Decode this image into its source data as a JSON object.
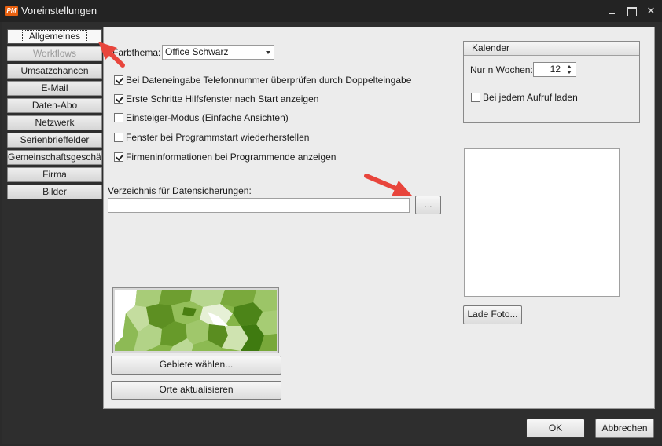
{
  "window": {
    "app_icon_text": "PM",
    "title": "Voreinstellungen",
    "minimize_label": "",
    "maximize_label": "",
    "close_label": "✕"
  },
  "nav": {
    "items": [
      {
        "label": "Allgemeines",
        "state": "active"
      },
      {
        "label": "Workflows",
        "state": "disabled"
      },
      {
        "label": "Umsatzchancen",
        "state": "normal"
      },
      {
        "label": "E-Mail",
        "state": "normal"
      },
      {
        "label": "Daten-Abo",
        "state": "normal"
      },
      {
        "label": "Netzwerk",
        "state": "normal"
      },
      {
        "label": "Serienbrieffelder",
        "state": "normal"
      },
      {
        "label": "Gemeinschaftsgeschäft",
        "state": "normal"
      },
      {
        "label": "Firma",
        "state": "normal"
      },
      {
        "label": "Bilder",
        "state": "normal"
      }
    ]
  },
  "general": {
    "theme_label": "Farbthema:",
    "theme_value": "Office Schwarz",
    "options": [
      {
        "label": "Bei Dateneingabe Telefonnummer überprüfen durch Doppelteingabe",
        "checked": true
      },
      {
        "label": "Erste Schritte Hilfsfenster nach Start anzeigen",
        "checked": true
      },
      {
        "label": "Einsteiger-Modus (Einfache Ansichten)",
        "checked": false
      },
      {
        "label": "Fenster bei Programmstart wiederherstellen",
        "checked": false
      },
      {
        "label": "Firmeninformationen bei Programmende anzeigen",
        "checked": true
      }
    ],
    "backup_dir_label": "Verzeichnis für Datensicherungen:",
    "backup_dir_value": "",
    "browse_label": "...",
    "gebiete_button": "Gebiete wählen...",
    "orte_button": "Orte aktualisieren"
  },
  "calendar": {
    "group_title": "Kalender",
    "weeks_label": "Nur n Wochen:",
    "weeks_value": "12",
    "load_each_label": "Bei jedem Aufruf laden",
    "load_each_checked": false
  },
  "photo": {
    "load_button": "Lade Foto..."
  },
  "footer": {
    "ok_label": "OK",
    "cancel_label": "Abbrechen"
  },
  "colors": {
    "annotation_arrow": "#e8453c",
    "map_green_dark": "#4f8a1a",
    "map_green_light": "#b5d58a"
  }
}
